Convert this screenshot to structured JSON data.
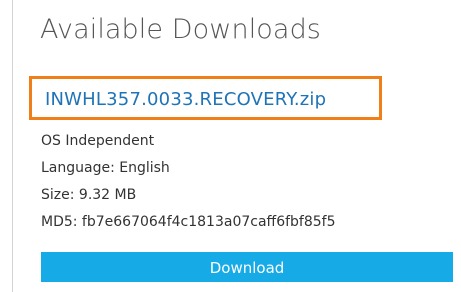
{
  "panel": {
    "heading": "Available Downloads"
  },
  "file": {
    "name": "INWHL357.0033.RECOVERY.zip",
    "highlight_color": "#f07f1a",
    "link_color": "#1f73b7"
  },
  "details": {
    "os": "OS Independent",
    "language": "Language: English",
    "size": "Size: 9.32 MB",
    "md5": "MD5: fb7e667064f4c1813a07caff6fbf85f5"
  },
  "actions": {
    "download_label": "Download",
    "button_color": "#16aae7"
  }
}
